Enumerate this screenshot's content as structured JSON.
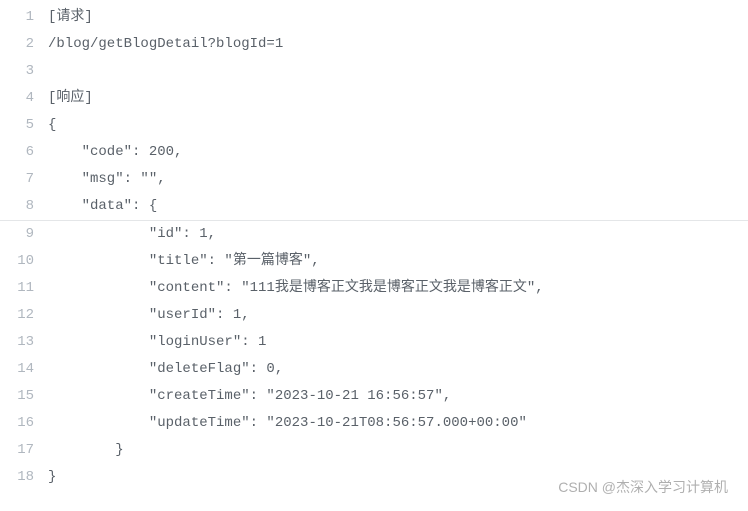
{
  "lines": [
    {
      "num": 1,
      "text": "[请求]"
    },
    {
      "num": 2,
      "text": "/blog/getBlogDetail?blogId=1"
    },
    {
      "num": 3,
      "text": ""
    },
    {
      "num": 4,
      "text": "[响应]"
    },
    {
      "num": 5,
      "text": "{"
    },
    {
      "num": 6,
      "text": "    \"code\": 200,"
    },
    {
      "num": 7,
      "text": "    \"msg\": \"\","
    },
    {
      "num": 8,
      "text": "    \"data\": {"
    },
    {
      "num": 9,
      "text": "            \"id\": 1,"
    },
    {
      "num": 10,
      "text": "            \"title\": \"第一篇博客\","
    },
    {
      "num": 11,
      "text": "            \"content\": \"111我是博客正文我是博客正文我是博客正文\","
    },
    {
      "num": 12,
      "text": "            \"userId\": 1,"
    },
    {
      "num": 13,
      "text": "            \"loginUser\": 1"
    },
    {
      "num": 14,
      "text": "            \"deleteFlag\": 0,"
    },
    {
      "num": 15,
      "text": "            \"createTime\": \"2023-10-21 16:56:57\","
    },
    {
      "num": 16,
      "text": "            \"updateTime\": \"2023-10-21T08:56:57.000+00:00\""
    },
    {
      "num": 17,
      "text": "        }"
    },
    {
      "num": 18,
      "text": "}"
    }
  ],
  "watermark": "CSDN @杰深入学习计算机"
}
